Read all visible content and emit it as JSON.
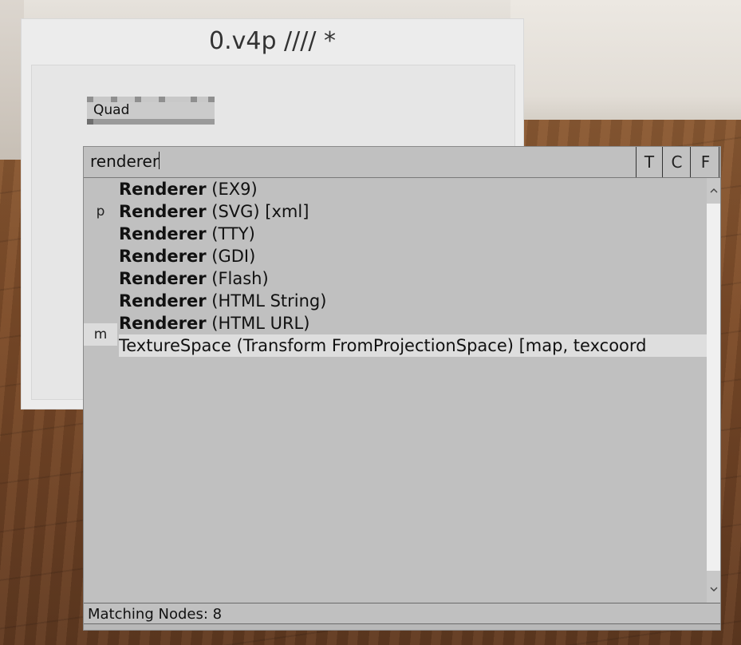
{
  "patch": {
    "title": "0.v4p //// *",
    "nodes": [
      {
        "label": "Quad"
      }
    ]
  },
  "browser": {
    "query": "renderer",
    "filters": [
      "T",
      "C",
      "F"
    ],
    "results": [
      {
        "tag": "",
        "bold": "Renderer",
        "rest": " (EX9)",
        "selected": false
      },
      {
        "tag": "p",
        "bold": "Renderer",
        "rest": " (SVG) [xml]",
        "selected": false
      },
      {
        "tag": "",
        "bold": "Renderer",
        "rest": " (TTY)",
        "selected": false
      },
      {
        "tag": "",
        "bold": "Renderer",
        "rest": " (GDI)",
        "selected": false
      },
      {
        "tag": "",
        "bold": "Renderer",
        "rest": " (Flash)",
        "selected": false
      },
      {
        "tag": "",
        "bold": "Renderer",
        "rest": " (HTML String)",
        "selected": false
      },
      {
        "tag": "",
        "bold": "Renderer",
        "rest": " (HTML URL)",
        "selected": false
      },
      {
        "tag": "m",
        "bold": "",
        "rest": "TextureSpace (Transform FromProjectionSpace) [map, texcoord",
        "selected": true
      }
    ],
    "scroll_up_icon": "chevron-up-icon",
    "scroll_down_icon": "chevron-down-icon",
    "status": "Matching Nodes: 8"
  }
}
